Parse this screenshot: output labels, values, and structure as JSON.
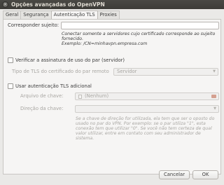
{
  "window": {
    "title": "Opções avançadas do OpenVPN",
    "close": "×"
  },
  "tabs": [
    {
      "label": "Geral",
      "active": false
    },
    {
      "label": "Segurança",
      "active": false
    },
    {
      "label": "Autenticação TLS",
      "active": true
    },
    {
      "label": "Proxies",
      "active": false
    }
  ],
  "subject": {
    "label": "Corresponder sujeito:",
    "value": "",
    "hint_line1": "Conectar somente a servidores cujo certificado corresponde ao sujeito",
    "hint_line2": "fornecido.",
    "hint_line3": "Exemplo: /CN=minhavpn.empresa.com"
  },
  "verify": {
    "label": "Verificar a assinatura de uso do par (servidor)",
    "checked": false,
    "cert_type_label": "Tipo de TLS do certificado do par remoto",
    "cert_type_value": "Servidor"
  },
  "tls_auth": {
    "label": "Usar autenticação TLS adicional",
    "checked": false,
    "key_file_label": "Arquivo de chave:",
    "key_file_value": "(Nenhum)",
    "key_direction_label": "Direção da chave:",
    "key_direction_value": "",
    "hint_line1": "Se a chave de direção for utilizada, ela tem que ser o oposto do",
    "hint_line2": "usado no par do VPN. Por exemplo: se o par utiliza \"1\", esta",
    "hint_line3": "conexão tem que utilizar \"0\". Se você não tem certeza de qual",
    "hint_line4": "valor utilizar, entre em contato com seu administrador de",
    "hint_line5": "sistema."
  },
  "buttons": {
    "cancel": "Cancelar",
    "ok": "OK"
  }
}
